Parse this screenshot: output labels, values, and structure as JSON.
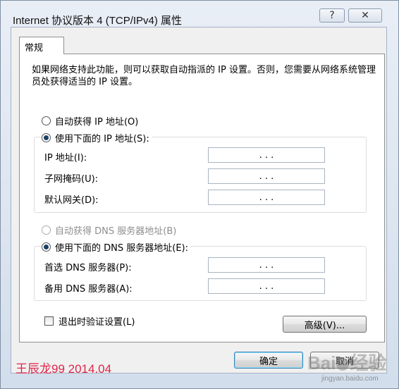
{
  "window": {
    "title": "Internet 协议版本 4 (TCP/IPv4) 属性",
    "help_glyph": "?",
    "close_glyph": "✕"
  },
  "tab": {
    "label": "常规"
  },
  "description": "如果网络支持此功能，则可以获取自动指派的 IP 设置。否则，您需要从网络系统管理员处获得适当的 IP 设置。",
  "ip_section": {
    "auto_option": {
      "label": "自动获得 IP 地址(O)",
      "checked": false
    },
    "manual_option": {
      "label": "使用下面的 IP 地址(S):",
      "checked": true
    },
    "fields": [
      {
        "label": "IP 地址(I):",
        "value": ". . ."
      },
      {
        "label": "子网掩码(U):",
        "value": ". . ."
      },
      {
        "label": "默认网关(D):",
        "value": ". . ."
      }
    ]
  },
  "dns_section": {
    "auto_option": {
      "label": "自动获得 DNS 服务器地址(B)",
      "checked": false,
      "disabled": true
    },
    "manual_option": {
      "label": "使用下面的 DNS 服务器地址(E):",
      "checked": true
    },
    "fields": [
      {
        "label": "首选 DNS 服务器(P):",
        "value": ". . ."
      },
      {
        "label": "备用 DNS 服务器(A):",
        "value": ". . ."
      }
    ]
  },
  "validate_checkbox": {
    "label": "退出时验证设置(L)",
    "checked": false
  },
  "buttons": {
    "advanced": "高级(V)...",
    "ok": "确定",
    "cancel": "取消"
  },
  "watermark": {
    "signature": "王辰龙99 2014.04",
    "logo_left": "Bai",
    "logo_right": "经验",
    "url": "jingyan.baidu.com"
  },
  "colors": {
    "signature": "#e0264a",
    "radio_dot": "#1c3f66",
    "ok_border": "#3c7fb1"
  }
}
